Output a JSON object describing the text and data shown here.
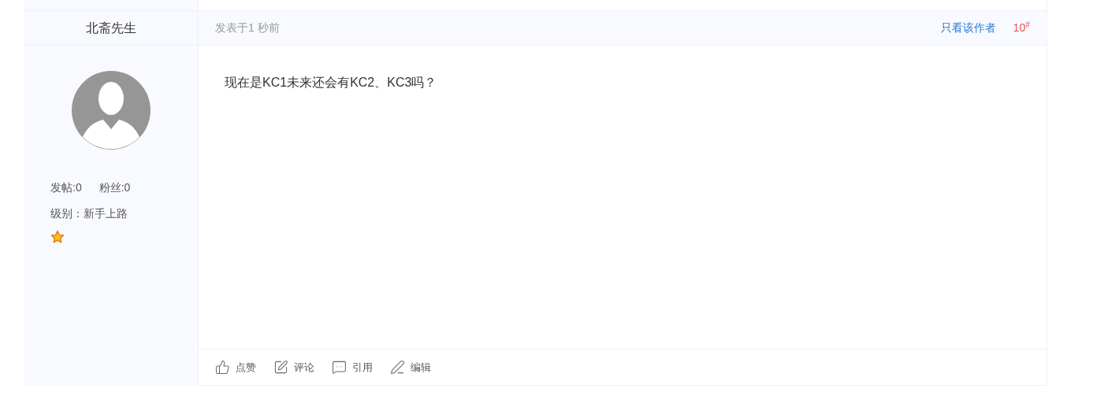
{
  "author": {
    "name": "北斋先生",
    "stats": [
      "发帖:0",
      "粉丝:0"
    ],
    "level": "级别：新手上路"
  },
  "post": {
    "time": "发表于1 秒前",
    "only_author": "只看该作者",
    "floor": "10",
    "floor_mark": "#",
    "content": "现在是KC1未来还会有KC2、KC3吗？"
  },
  "actions": [
    {
      "kind": "like",
      "label": "点赞"
    },
    {
      "kind": "comment",
      "label": "评论"
    },
    {
      "kind": "quote",
      "label": "引用"
    },
    {
      "kind": "edit",
      "label": "编辑"
    }
  ]
}
